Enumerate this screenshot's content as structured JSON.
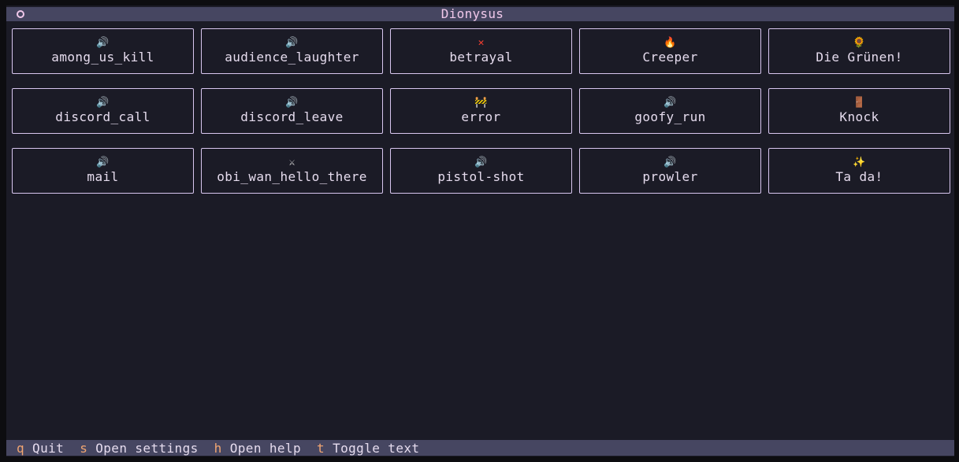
{
  "window": {
    "title": "Dionysus"
  },
  "sounds": [
    {
      "label": "among_us_kill",
      "icon": "speaker-icon",
      "glyph": "🔊"
    },
    {
      "label": "audience_laughter",
      "icon": "speaker-icon",
      "glyph": "🔊"
    },
    {
      "label": "betrayal",
      "icon": "cross-icon",
      "glyph": "✕"
    },
    {
      "label": "Creeper",
      "icon": "fire-icon",
      "glyph": "🔥"
    },
    {
      "label": "Die Grünen!",
      "icon": "sunflower-icon",
      "glyph": "🌻"
    },
    {
      "label": "discord_call",
      "icon": "speaker-icon",
      "glyph": "🔊"
    },
    {
      "label": "discord_leave",
      "icon": "speaker-icon",
      "glyph": "🔊"
    },
    {
      "label": "error",
      "icon": "construction-barrier-icon",
      "glyph": "🚧"
    },
    {
      "label": "goofy_run",
      "icon": "speaker-icon",
      "glyph": "🔊"
    },
    {
      "label": "Knock",
      "icon": "door-icon",
      "glyph": "🚪"
    },
    {
      "label": "mail",
      "icon": "speaker-icon",
      "glyph": "🔊"
    },
    {
      "label": "obi_wan_hello_there",
      "icon": "crossed-swords-icon",
      "glyph": "⚔"
    },
    {
      "label": "pistol-shot",
      "icon": "speaker-icon",
      "glyph": "🔊"
    },
    {
      "label": "prowler",
      "icon": "speaker-icon",
      "glyph": "🔊"
    },
    {
      "label": "Ta da!",
      "icon": "sparkles-icon",
      "glyph": "✨"
    }
  ],
  "statusbar": [
    {
      "key": "q",
      "label": "Quit"
    },
    {
      "key": "s",
      "label": "Open settings"
    },
    {
      "key": "h",
      "label": "Open help"
    },
    {
      "key": "t",
      "label": "Toggle text"
    }
  ],
  "colors": {
    "background": "#1b1b26",
    "bar": "#464661",
    "border": "#d8c6ef",
    "title": "#f0c8ea",
    "key": "#f2a672",
    "speaker": "#78c8e6"
  }
}
